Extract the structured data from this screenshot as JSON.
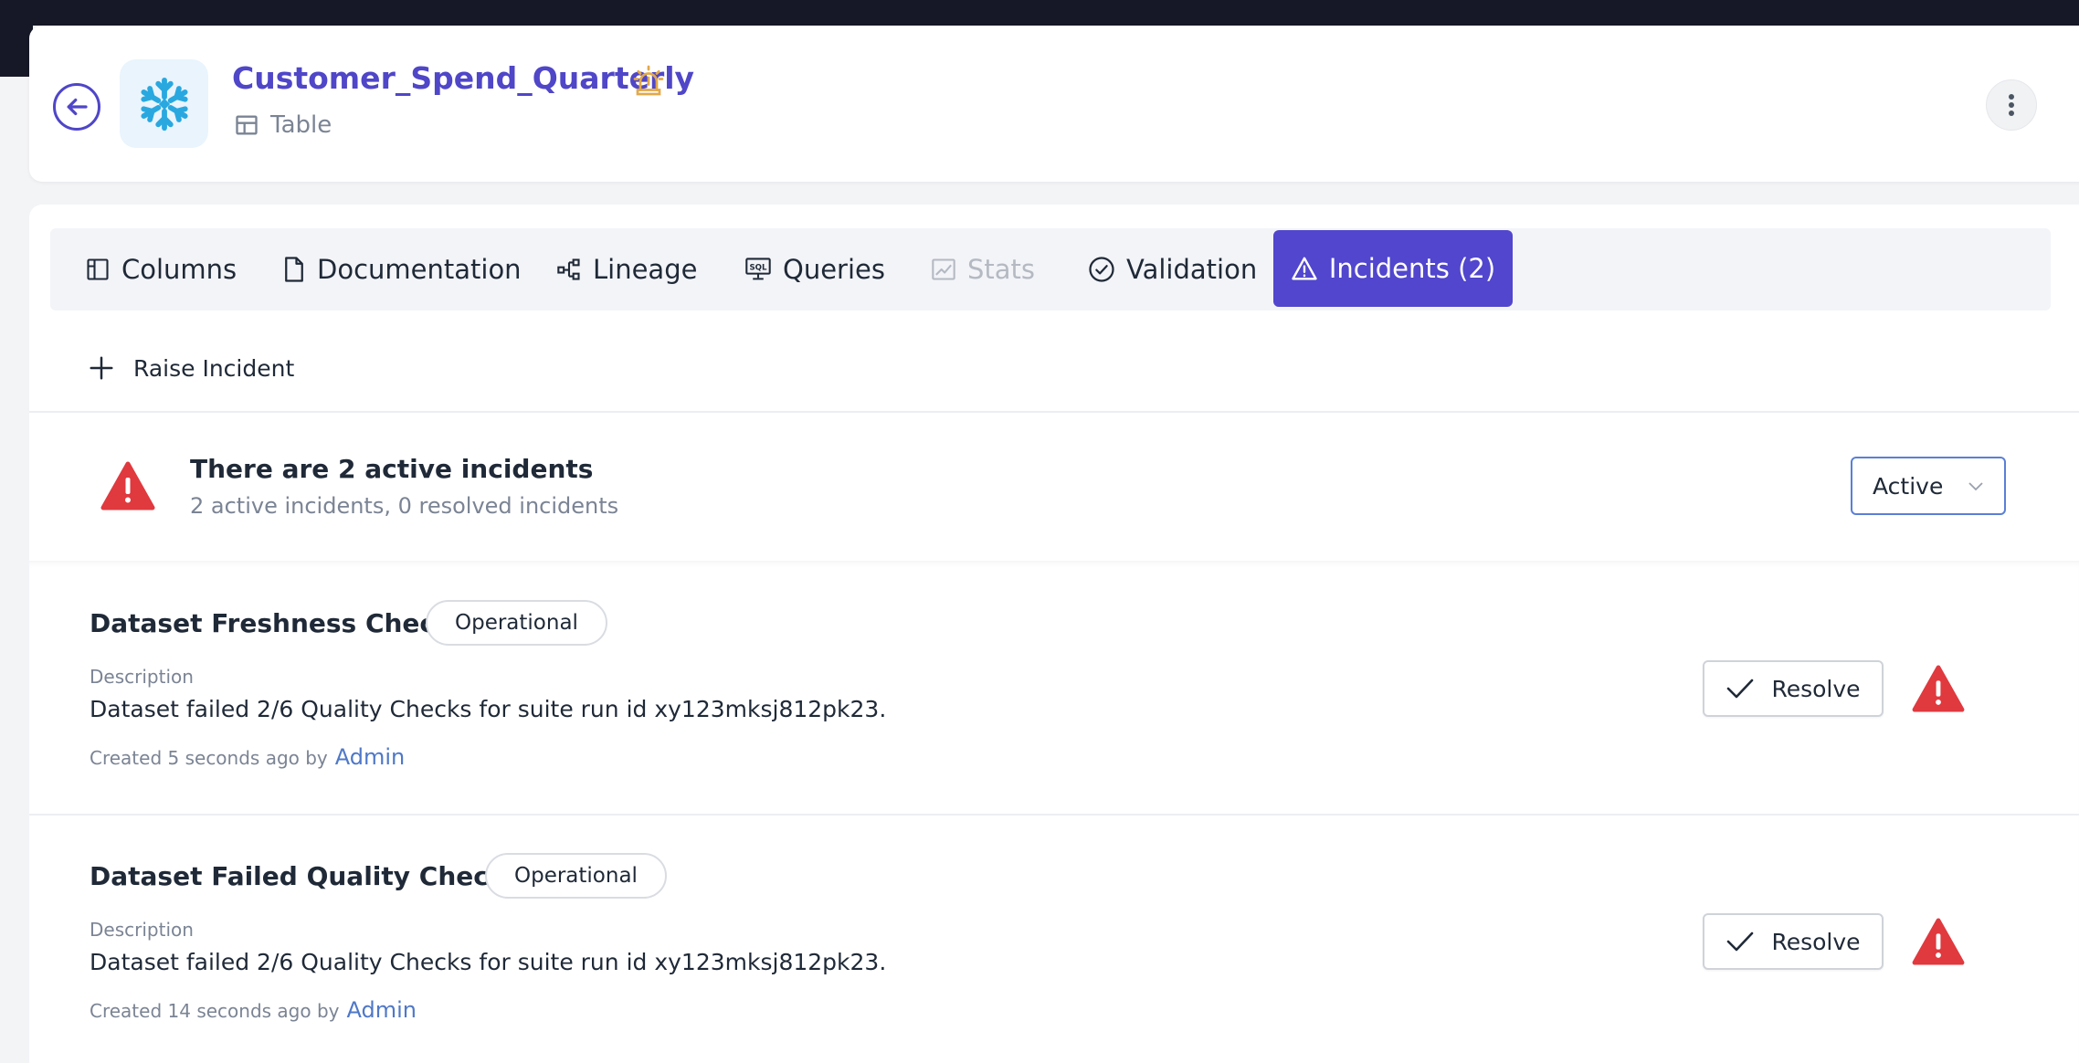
{
  "header": {
    "title": "Customer_Spend_Quarterly",
    "type": "Table",
    "logo_icon": "snowflake-icon",
    "badge_icon": "alarm-icon"
  },
  "tabs": [
    {
      "label": "Columns",
      "icon": "columns-icon"
    },
    {
      "label": "Documentation",
      "icon": "document-icon"
    },
    {
      "label": "Lineage",
      "icon": "lineage-icon"
    },
    {
      "label": "Queries",
      "icon": "sql-icon"
    },
    {
      "label": "Stats",
      "icon": "chart-icon",
      "disabled": true
    },
    {
      "label": "Validation",
      "icon": "check-circle-icon"
    },
    {
      "label": "Incidents (2)",
      "icon": "warning-icon",
      "active": true
    }
  ],
  "toolbar": {
    "raise_label": "Raise Incident"
  },
  "summary": {
    "title": "There are 2 active incidents",
    "subtitle": "2 active incidents, 0 resolved incidents",
    "filter_value": "Active"
  },
  "incidents": [
    {
      "title": "Dataset Freshness Check",
      "badge": "Operational",
      "desc_label": "Description",
      "description": "Dataset failed 2/6 Quality Checks for suite run id xy123mksj812pk23.",
      "created": "Created 5 seconds ago by",
      "author": "Admin",
      "resolve_label": "Resolve"
    },
    {
      "title": "Dataset Failed Quality Checks",
      "badge": "Operational",
      "desc_label": "Description",
      "description": "Dataset failed 2/6 Quality Checks for suite run id xy123mksj812pk23.",
      "created": "Created 14 seconds ago by",
      "author": "Admin",
      "resolve_label": "Resolve"
    }
  ],
  "colors": {
    "accent": "#5146cd",
    "title": "#4f46c8",
    "danger": "#e0393e",
    "link": "#4f78c8",
    "alarm": "#e2a94a"
  }
}
